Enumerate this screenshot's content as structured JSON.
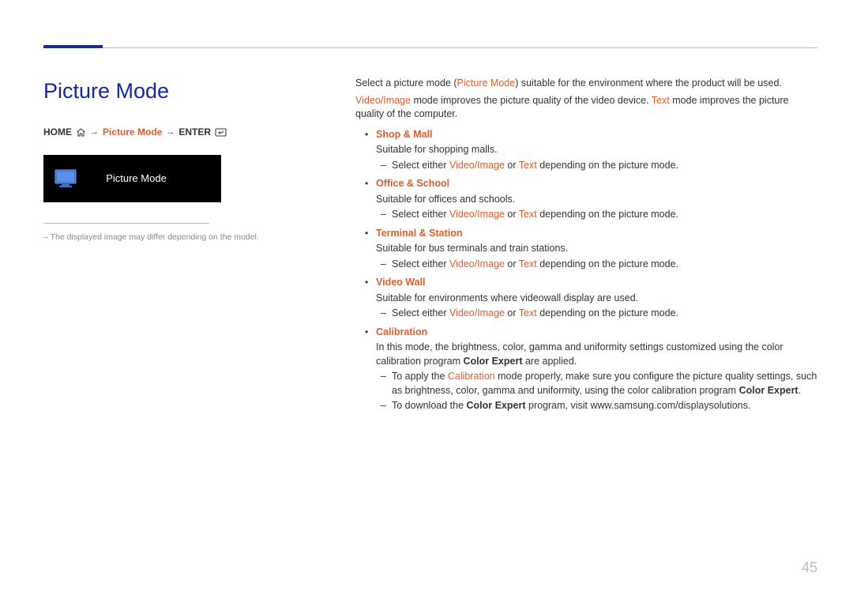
{
  "page": {
    "title": "Picture Mode",
    "page_number": "45"
  },
  "breadcrumb": {
    "home": "HOME",
    "mode": "Picture Mode",
    "enter": "ENTER",
    "arrow": "→"
  },
  "screenshot": {
    "label": "Picture Mode"
  },
  "left_footnote": "The displayed image may differ depending on the model.",
  "intro": {
    "l1a": "Select a picture mode (",
    "l1b": "Picture Mode",
    "l1c": ") suitable for the environment where the product will be used.",
    "l2a": "Video/Image",
    "l2b": " mode improves the picture quality of the video device. ",
    "l2c": "Text",
    "l2d": " mode improves the picture quality of the computer."
  },
  "select_line": {
    "a": "Select either ",
    "b": "Video/Image",
    "c": " or ",
    "d": "Text",
    "e": " depending on the picture mode."
  },
  "modes": {
    "shop": {
      "name": "Shop & Mall",
      "desc": "Suitable for shopping malls."
    },
    "office": {
      "name": "Office & School",
      "desc": "Suitable for offices and schools."
    },
    "terminal": {
      "name": "Terminal & Station",
      "desc": "Suitable for bus terminals and train stations."
    },
    "wall": {
      "name": "Video Wall",
      "desc": "Suitable for environments where videowall display are used."
    },
    "cal": {
      "name": "Calibration",
      "desc_a": "In this mode, the brightness, color, gamma and uniformity settings customized using the color calibration program ",
      "desc_b": "Color Expert",
      "desc_c": " are applied.",
      "sub1_a": "To apply the ",
      "sub1_b": "Calibration",
      "sub1_c": " mode properly, make sure you configure the picture quality settings, such as brightness, color, gamma and uniformity, using the color calibration program ",
      "sub1_d": "Color Expert",
      "sub1_e": ".",
      "sub2_a": "To download the ",
      "sub2_b": "Color Expert",
      "sub2_c": " program, visit www.samsung.com/displaysolutions."
    }
  }
}
